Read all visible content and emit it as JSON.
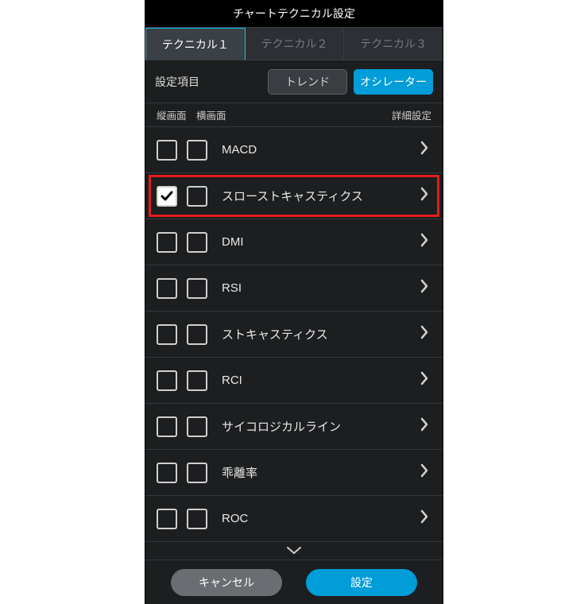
{
  "title": "チャートテクニカル設定",
  "tabs": [
    {
      "label": "テクニカル１",
      "active": true
    },
    {
      "label": "テクニカル２",
      "active": false
    },
    {
      "label": "テクニカル３",
      "active": false
    }
  ],
  "filter_label": "設定項目",
  "segments": [
    {
      "label": "トレンド",
      "active": false
    },
    {
      "label": "オシレーター",
      "active": true
    }
  ],
  "columns": {
    "col1": "縦画面",
    "col2": "横画面",
    "col3": "詳細設定"
  },
  "items": [
    {
      "label": "MACD",
      "portrait": false,
      "landscape": false,
      "highlight": false
    },
    {
      "label": "スローストキャスティクス",
      "portrait": true,
      "landscape": false,
      "highlight": true
    },
    {
      "label": "DMI",
      "portrait": false,
      "landscape": false,
      "highlight": false
    },
    {
      "label": "RSI",
      "portrait": false,
      "landscape": false,
      "highlight": false
    },
    {
      "label": "ストキャスティクス",
      "portrait": false,
      "landscape": false,
      "highlight": false
    },
    {
      "label": "RCI",
      "portrait": false,
      "landscape": false,
      "highlight": false
    },
    {
      "label": "サイコロジカルライン",
      "portrait": false,
      "landscape": false,
      "highlight": false
    },
    {
      "label": "乖離率",
      "portrait": false,
      "landscape": false,
      "highlight": false
    },
    {
      "label": "ROC",
      "portrait": false,
      "landscape": false,
      "highlight": false
    }
  ],
  "footer": {
    "cancel": "キャンセル",
    "confirm": "設定"
  }
}
